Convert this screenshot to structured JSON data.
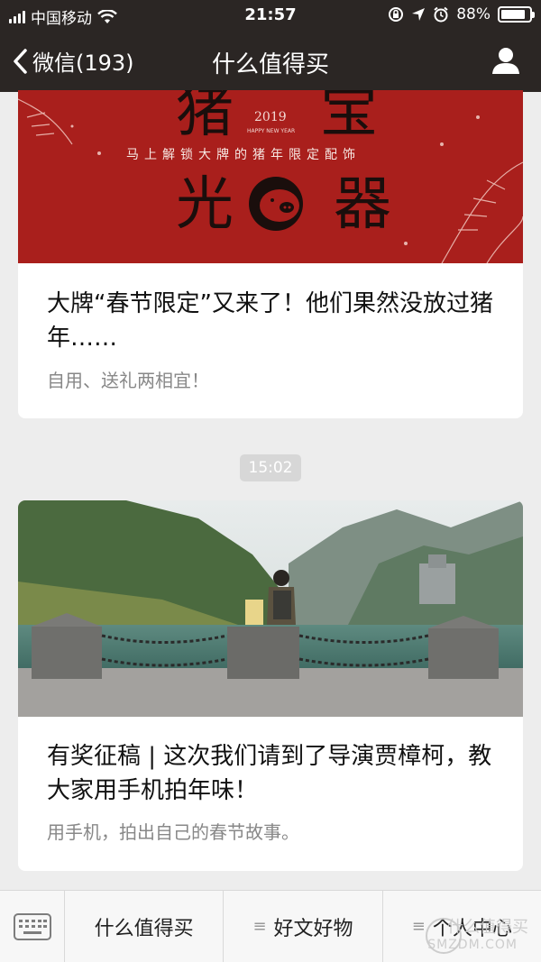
{
  "status": {
    "carrier": "中国移动",
    "time": "21:57",
    "battery": "88%",
    "battery_level": 0.88
  },
  "nav": {
    "back_label": "微信(193)",
    "title": "什么值得买"
  },
  "card1": {
    "banner_text": {
      "chars": [
        "猪",
        "宝",
        "光",
        "器"
      ],
      "subtitle": "马上解锁大牌的猪年限定配饰",
      "year": "2019",
      "tag": "HAPPY NEW YEAR"
    },
    "headline": "大牌“春节限定”又来了！他们果然没放过猪年……",
    "description": "自用、送礼两相宜！"
  },
  "timestamp": "15:02",
  "card2": {
    "headline": "有奖征稿 | 这次我们请到了导演贾樟柯，教大家用手机拍年味！",
    "description": "用手机，拍出自己的春节故事。"
  },
  "menu": {
    "items": [
      {
        "label": "什么值得买",
        "has_submenu": false
      },
      {
        "label": "好文好物",
        "has_submenu": true
      },
      {
        "label": "个人中心",
        "has_submenu": true
      }
    ]
  },
  "watermark": {
    "line1": "什么值得买",
    "line2": "SMZDM.COM"
  },
  "colors": {
    "topbar": "#2b2624",
    "banner_red": "#a91f1c",
    "background": "#ededed"
  }
}
